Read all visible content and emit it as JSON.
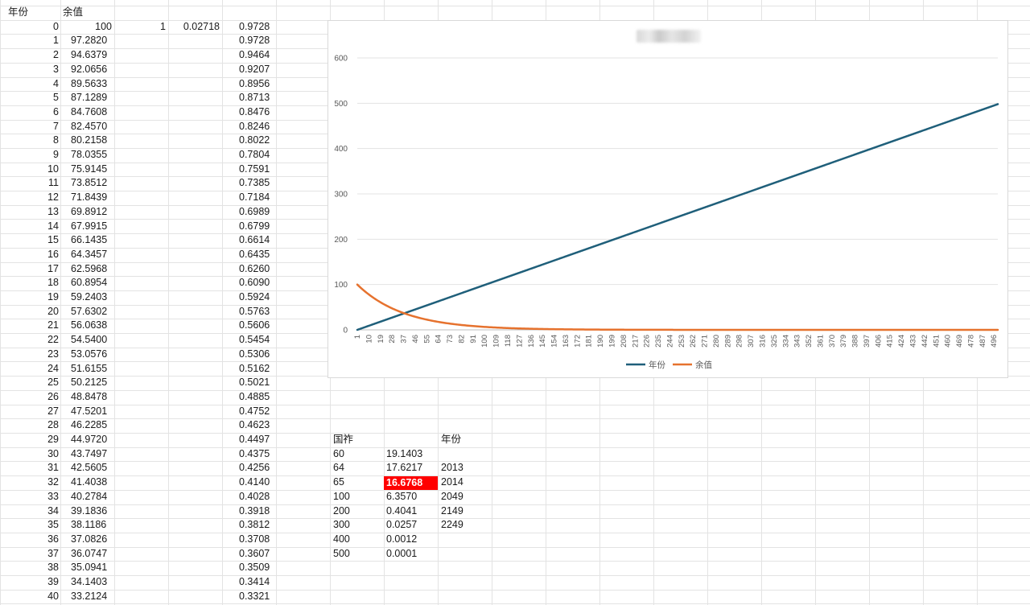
{
  "sheet": {
    "header": {
      "col_a": "年份",
      "col_b": "余值"
    },
    "constants": {
      "c_value": "1",
      "d_value": "0.02718"
    },
    "rows": [
      {
        "a": "0",
        "b": "100",
        "e": "0.9728"
      },
      {
        "a": "1",
        "b": "97.2820",
        "e": "0.9728"
      },
      {
        "a": "2",
        "b": "94.6379",
        "e": "0.9464"
      },
      {
        "a": "3",
        "b": "92.0656",
        "e": "0.9207"
      },
      {
        "a": "4",
        "b": "89.5633",
        "e": "0.8956"
      },
      {
        "a": "5",
        "b": "87.1289",
        "e": "0.8713"
      },
      {
        "a": "6",
        "b": "84.7608",
        "e": "0.8476"
      },
      {
        "a": "7",
        "b": "82.4570",
        "e": "0.8246"
      },
      {
        "a": "8",
        "b": "80.2158",
        "e": "0.8022"
      },
      {
        "a": "9",
        "b": "78.0355",
        "e": "0.7804"
      },
      {
        "a": "10",
        "b": "75.9145",
        "e": "0.7591"
      },
      {
        "a": "11",
        "b": "73.8512",
        "e": "0.7385"
      },
      {
        "a": "12",
        "b": "71.8439",
        "e": "0.7184"
      },
      {
        "a": "13",
        "b": "69.8912",
        "e": "0.6989"
      },
      {
        "a": "14",
        "b": "67.9915",
        "e": "0.6799"
      },
      {
        "a": "15",
        "b": "66.1435",
        "e": "0.6614"
      },
      {
        "a": "16",
        "b": "64.3457",
        "e": "0.6435"
      },
      {
        "a": "17",
        "b": "62.5968",
        "e": "0.6260"
      },
      {
        "a": "18",
        "b": "60.8954",
        "e": "0.6090"
      },
      {
        "a": "19",
        "b": "59.2403",
        "e": "0.5924"
      },
      {
        "a": "20",
        "b": "57.6302",
        "e": "0.5763"
      },
      {
        "a": "21",
        "b": "56.0638",
        "e": "0.5606"
      },
      {
        "a": "22",
        "b": "54.5400",
        "e": "0.5454"
      },
      {
        "a": "23",
        "b": "53.0576",
        "e": "0.5306"
      },
      {
        "a": "24",
        "b": "51.6155",
        "e": "0.5162"
      },
      {
        "a": "25",
        "b": "50.2125",
        "e": "0.5021"
      },
      {
        "a": "26",
        "b": "48.8478",
        "e": "0.4885"
      },
      {
        "a": "27",
        "b": "47.5201",
        "e": "0.4752"
      },
      {
        "a": "28",
        "b": "46.2285",
        "e": "0.4623"
      },
      {
        "a": "29",
        "b": "44.9720",
        "e": "0.4497"
      },
      {
        "a": "30",
        "b": "43.7497",
        "e": "0.4375"
      },
      {
        "a": "31",
        "b": "42.5605",
        "e": "0.4256"
      },
      {
        "a": "32",
        "b": "41.4038",
        "e": "0.4140"
      },
      {
        "a": "33",
        "b": "40.2784",
        "e": "0.4028"
      },
      {
        "a": "34",
        "b": "39.1836",
        "e": "0.3918"
      },
      {
        "a": "35",
        "b": "38.1186",
        "e": "0.3812"
      },
      {
        "a": "36",
        "b": "37.0826",
        "e": "0.3708"
      },
      {
        "a": "37",
        "b": "36.0747",
        "e": "0.3607"
      },
      {
        "a": "38",
        "b": "35.0941",
        "e": "0.3509"
      },
      {
        "a": "39",
        "b": "34.1403",
        "e": "0.3414"
      },
      {
        "a": "40",
        "b": "33.2124",
        "e": "0.3321"
      }
    ]
  },
  "lookup": {
    "header_left": "国祚",
    "header_right": "年份",
    "rows": [
      {
        "a": "60",
        "b": "19.1403",
        "c": ""
      },
      {
        "a": "64",
        "b": "17.6217",
        "c": "2013"
      },
      {
        "a": "65",
        "b": "16.6768",
        "c": "2014",
        "highlight": true
      },
      {
        "a": "100",
        "b": "6.3570",
        "c": "2049"
      },
      {
        "a": "200",
        "b": "0.4041",
        "c": "2149"
      },
      {
        "a": "300",
        "b": "0.0257",
        "c": "2249"
      },
      {
        "a": "400",
        "b": "0.0012",
        "c": ""
      },
      {
        "a": "500",
        "b": "0.0001",
        "c": ""
      }
    ],
    "highlight_color": "#ff0000"
  },
  "chart_data": {
    "type": "line",
    "title": "",
    "x_start": 1,
    "x_end": 499,
    "x_tick_labels": [
      "1",
      "10",
      "19",
      "28",
      "37",
      "46",
      "55",
      "64",
      "73",
      "82",
      "91",
      "100",
      "109",
      "118",
      "127",
      "136",
      "145",
      "154",
      "163",
      "172",
      "181",
      "190",
      "199",
      "208",
      "217",
      "226",
      "235",
      "244",
      "253",
      "262",
      "271",
      "280",
      "289",
      "298",
      "307",
      "316",
      "325",
      "334",
      "343",
      "352",
      "361",
      "370",
      "379",
      "388",
      "397",
      "406",
      "415",
      "424",
      "433",
      "442",
      "451",
      "460",
      "469",
      "478",
      "487",
      "496"
    ],
    "ylim": [
      0,
      600
    ],
    "y_ticks": [
      "0",
      "100",
      "200",
      "300",
      "400",
      "500",
      "600"
    ],
    "grid": true,
    "legend_position": "bottom",
    "series": [
      {
        "name": "年份",
        "color": "#1f5f7a",
        "formula": "x-1",
        "values_sample": {
          "x": [
            1,
            100,
            250,
            499
          ],
          "y": [
            0,
            99,
            249,
            498
          ]
        }
      },
      {
        "name": "余值",
        "color": "#e6722e",
        "formula": "100*0.97282^(x-1)",
        "values_sample": {
          "x": [
            1,
            25,
            50,
            100,
            200,
            499
          ],
          "y": [
            100,
            51.6,
            26.0,
            6.6,
            0.42,
            0
          ]
        }
      }
    ]
  }
}
